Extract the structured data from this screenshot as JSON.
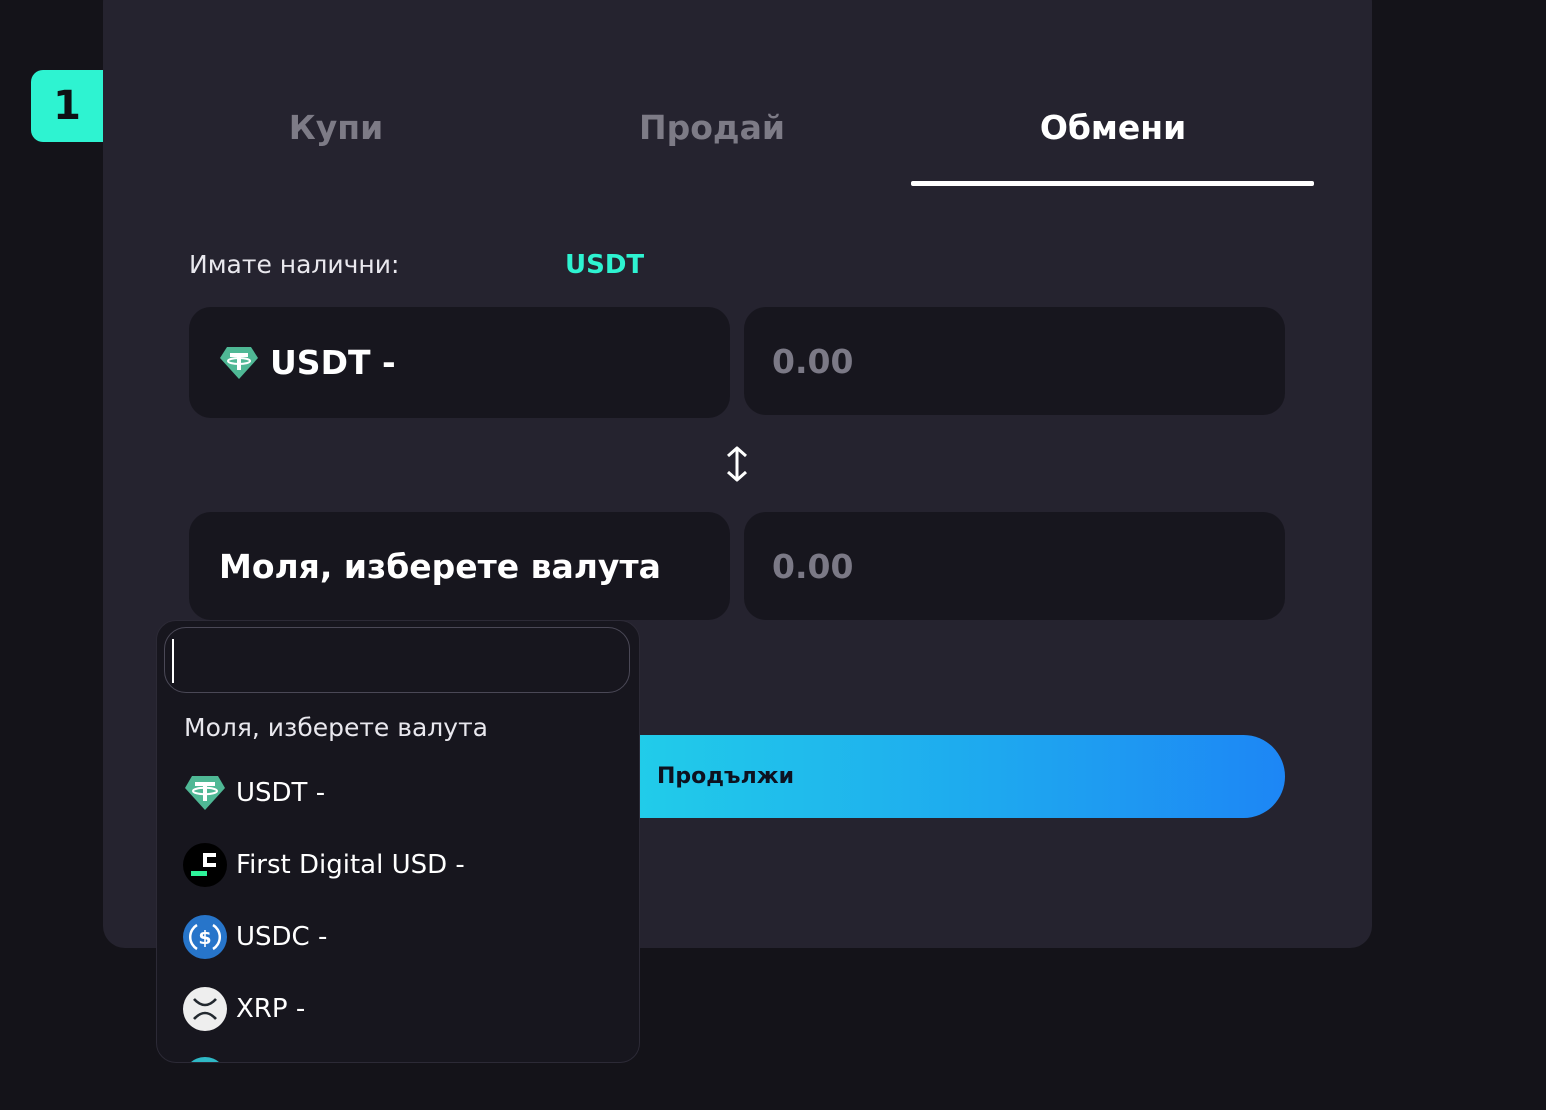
{
  "step_badge": "1",
  "tabs": [
    {
      "label": "Купи",
      "active": false
    },
    {
      "label": "Продай",
      "active": false
    },
    {
      "label": "Обмени",
      "active": true
    }
  ],
  "available": {
    "label": "Имате налични:",
    "currency": "USDT"
  },
  "from": {
    "currency_label": "USDT -",
    "icon": "tether-icon",
    "amount_placeholder": "0.00"
  },
  "to": {
    "currency_label": "Моля, изберете валута",
    "amount_placeholder": "0.00"
  },
  "continue_label": "Продължи",
  "dropdown": {
    "search_value": "",
    "placeholder_option": "Моля, изберете валута",
    "options": [
      {
        "label": "USDT -",
        "icon": "tether-icon"
      },
      {
        "label": "First Digital USD -",
        "icon": "fdusd-icon"
      },
      {
        "label": "USDC -",
        "icon": "usdc-icon"
      },
      {
        "label": "XRP -",
        "icon": "xrp-icon"
      }
    ]
  },
  "colors": {
    "accent": "#2ef3d1",
    "card_bg": "#25232f",
    "field_bg": "#17161e",
    "button_gradient_start": "#22d4e8",
    "button_gradient_end": "#1d86f5"
  }
}
